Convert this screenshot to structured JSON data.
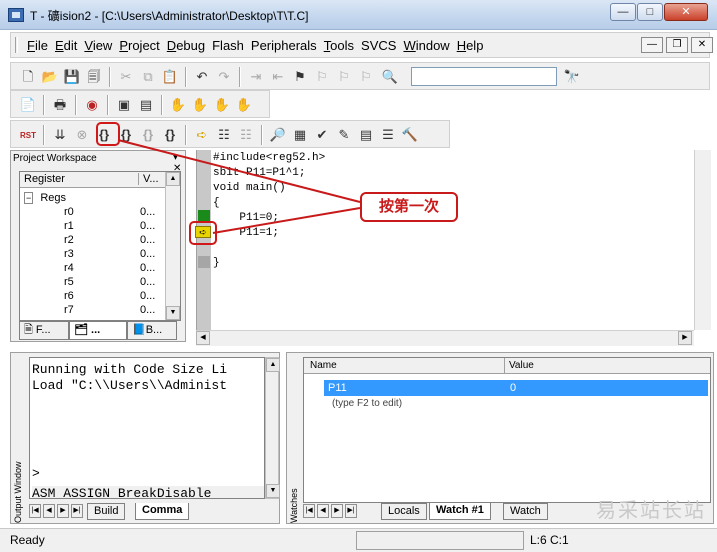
{
  "window": {
    "title": "T  - 礦ision2 - [C:\\Users\\Administrator\\Desktop\\T\\T.C]",
    "min_label": "—",
    "max_label": "□",
    "close_label": "✕"
  },
  "menu": {
    "items": [
      {
        "u": "F",
        "rest": "ile"
      },
      {
        "u": "E",
        "rest": "dit"
      },
      {
        "u": "V",
        "rest": "iew"
      },
      {
        "u": "P",
        "rest": "roject"
      },
      {
        "u": "D",
        "rest": "ebug"
      },
      {
        "u": "",
        "rest": "Flash"
      },
      {
        "u": "",
        "rest": "Peripherals"
      },
      {
        "u": "T",
        "rest": "ools"
      },
      {
        "u": "",
        "rest": "SVCS"
      },
      {
        "u": "W",
        "rest": "indow"
      },
      {
        "u": "H",
        "rest": "elp"
      }
    ],
    "mdi_min": "—",
    "mdi_restore": "❐",
    "mdi_close": "✕"
  },
  "toolbar": {
    "find_value": "",
    "reset_label": "RST"
  },
  "workspace": {
    "title": "Project Workspace",
    "col_register": "Register",
    "col_value": "V...",
    "group": "Regs",
    "registers": [
      {
        "name": "r0",
        "value": "0..."
      },
      {
        "name": "r1",
        "value": "0..."
      },
      {
        "name": "r2",
        "value": "0..."
      },
      {
        "name": "r3",
        "value": "0..."
      },
      {
        "name": "r4",
        "value": "0..."
      },
      {
        "name": "r5",
        "value": "0..."
      },
      {
        "name": "r6",
        "value": "0..."
      },
      {
        "name": "r7",
        "value": "0..."
      }
    ],
    "tabs": [
      "F...",
      "...",
      "B..."
    ]
  },
  "editor": {
    "lines": [
      "#include<reg52.h>",
      "sbit P11=P1^1;",
      "void main()",
      "{",
      "    P11=0;",
      "    P11=1;",
      "",
      "}"
    ]
  },
  "annotation": {
    "callout": "按第一次"
  },
  "output": {
    "label": "Output Window",
    "lines": [
      "Running with Code Size Li",
      "Load \"C:\\\\Users\\\\Administ"
    ],
    "prompt": ">",
    "command": "ASM ASSIGN BreakDisable",
    "tabs": [
      "Build",
      "Comma"
    ]
  },
  "watches": {
    "label": "Watches",
    "col_name": "Name",
    "col_value": "Value",
    "row": {
      "name": "P11",
      "value": "0"
    },
    "edit_hint": "(type F2 to edit)",
    "tabs": [
      "Locals",
      "Watch #1",
      "Watch"
    ]
  },
  "status": {
    "text": "Ready",
    "position": "L:6 C:1"
  },
  "watermark": "易采站长站"
}
